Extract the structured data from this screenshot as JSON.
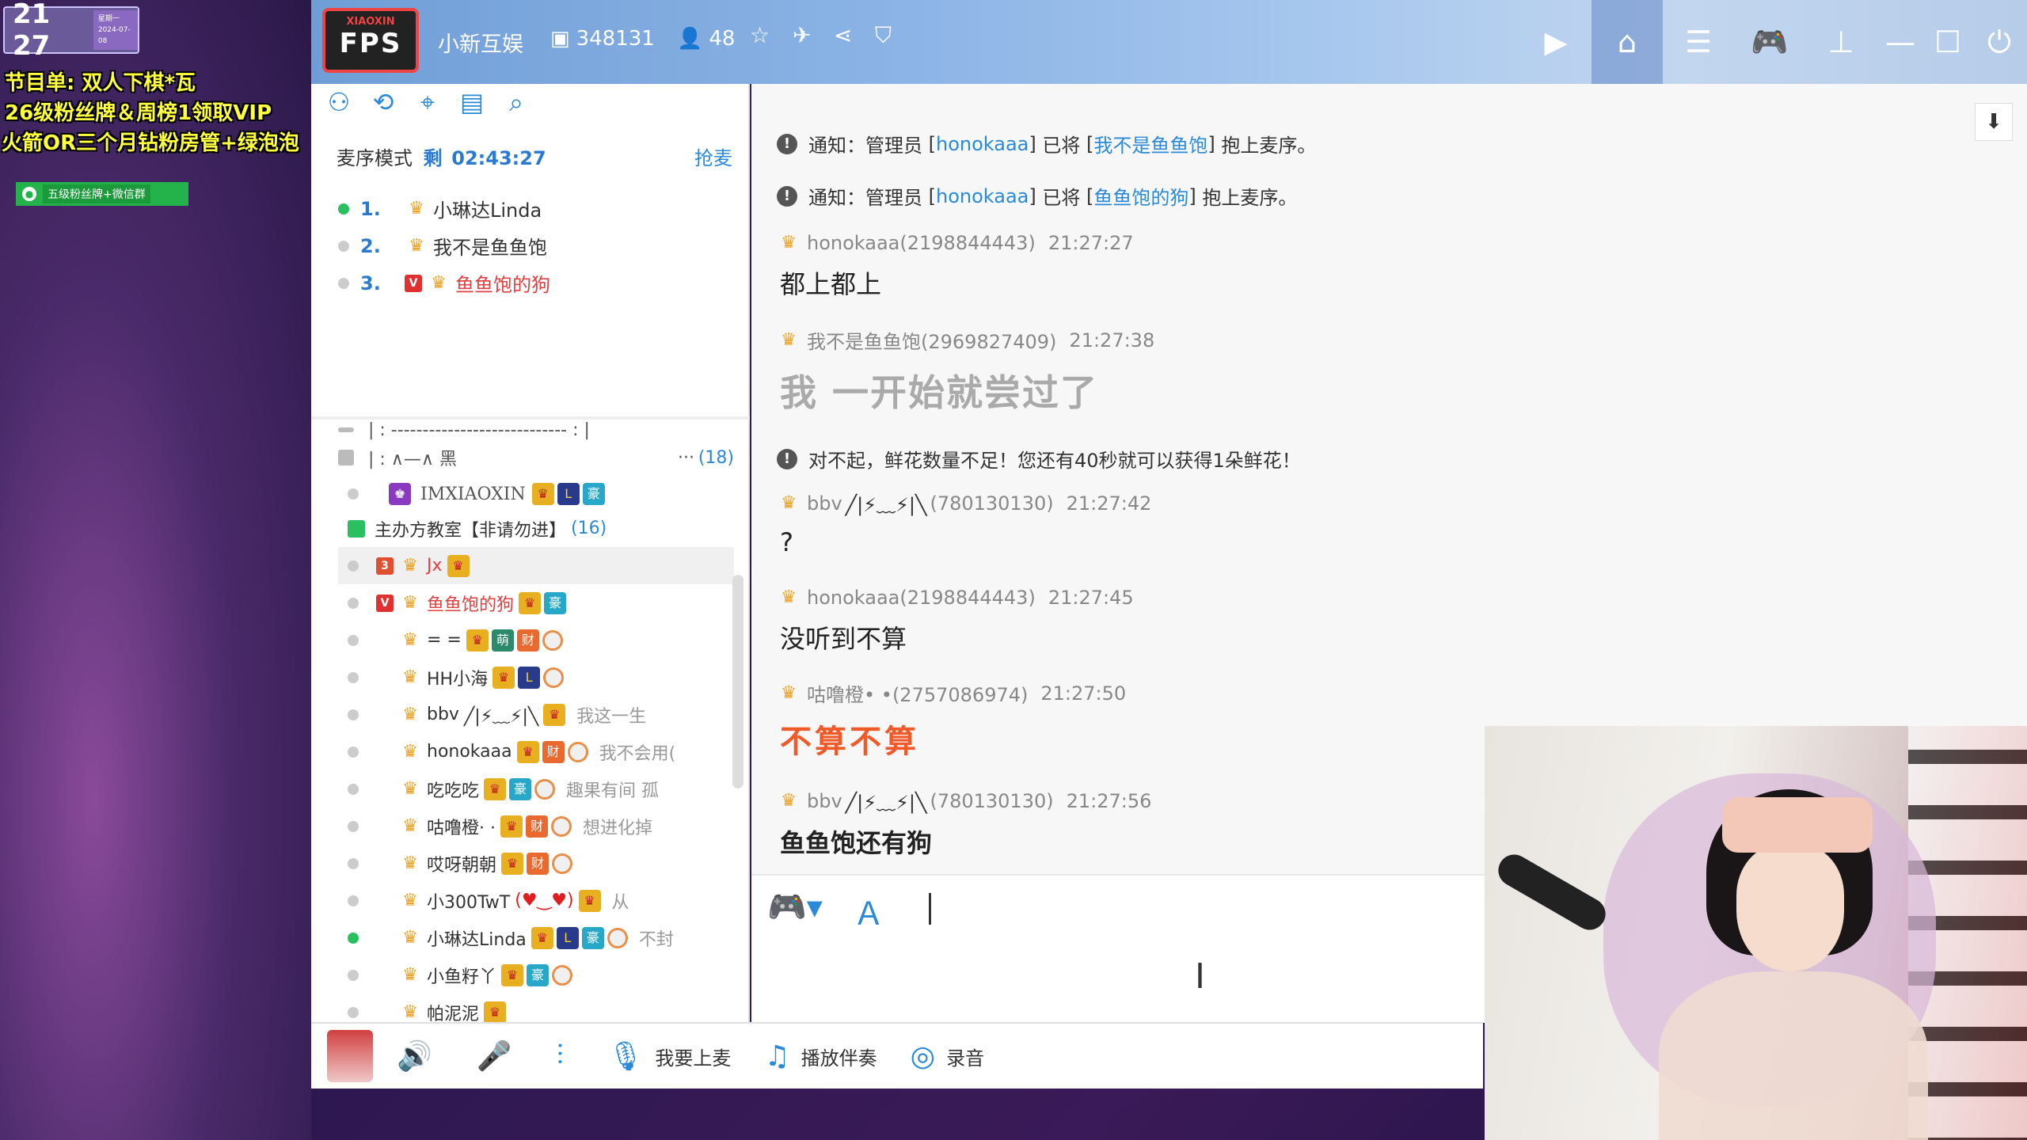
{
  "overlay": {
    "clock": "21 27",
    "clock_sub_line1": "星期一",
    "clock_sub_line2": "2024-07-08",
    "line1": "节目单: 双人下棋*瓦",
    "line2": "26级粉丝牌＆周榜1领取VIP",
    "line3": "火箭OR三个月钻粉房管+绿泡泡",
    "wechat_label": "五级粉丝牌+微信群"
  },
  "topbar": {
    "logo_top": "XIAOXIN",
    "logo_main": "FPS",
    "room_name": "小新互娱",
    "room_id": "348131",
    "online_count": "48"
  },
  "left": {
    "mode_label": "麦序模式",
    "remaining_label": "剩",
    "remaining_time": "02:43:27",
    "grab_mic": "抢麦",
    "queue": [
      {
        "num": "1.",
        "name": "小琳达Linda",
        "online": true,
        "red": false,
        "v": false
      },
      {
        "num": "2.",
        "name": "我不是鱼鱼饱",
        "online": false,
        "red": false,
        "v": false
      },
      {
        "num": "3.",
        "name": "鱼鱼饱的狗",
        "online": false,
        "red": true,
        "v": true
      }
    ],
    "channel_dashes": "| :  ----------------------------  :  |",
    "channel_name": "| :          ∧—∧         黑",
    "channel_more": "···",
    "channel_count": "(18)",
    "top_user": "IMXIAOXIN",
    "sub_channel": "主办方教室【非请勿进】",
    "sub_channel_count": "(16)",
    "users": [
      {
        "name": "Jx",
        "sig": "",
        "online": false,
        "red": true,
        "sel": true
      },
      {
        "name": "鱼鱼饱的狗",
        "sig": "",
        "online": false,
        "red": true,
        "sel": false
      },
      {
        "name": "= =",
        "sig": "",
        "online": false,
        "red": false,
        "sel": false
      },
      {
        "name": "HH小海",
        "sig": "",
        "online": false,
        "red": false,
        "sel": false
      },
      {
        "name": "bbv",
        "sig": "我这一生",
        "online": false,
        "red": false,
        "sel": false
      },
      {
        "name": "honokaaa",
        "sig": "我不会用(",
        "online": false,
        "red": false,
        "sel": false
      },
      {
        "name": "吃吃吃",
        "sig": "趣果有间 孤",
        "online": false,
        "red": false,
        "sel": false
      },
      {
        "name": "咕噜橙· ·",
        "sig": "想进化掉",
        "online": false,
        "red": false,
        "sel": false
      },
      {
        "name": "哎呀朝朝",
        "sig": "",
        "online": false,
        "red": false,
        "sel": false
      },
      {
        "name": "小300TwT",
        "sig": "从",
        "online": false,
        "red": false,
        "sel": false
      },
      {
        "name": "小琳达Linda",
        "sig": "不封",
        "online": true,
        "red": false,
        "sel": false
      },
      {
        "name": "小鱼籽丫",
        "sig": "",
        "online": false,
        "red": false,
        "sel": false
      },
      {
        "name": "帕泥泥",
        "sig": "",
        "online": false,
        "red": false,
        "sel": false
      }
    ]
  },
  "chat": {
    "notice_prefix": "通知：管理员",
    "admin": "honokaaa",
    "notice_mid": "已将",
    "notice_suffix": "抱上麦序。",
    "target1": "我不是鱼鱼饱",
    "target2": "鱼鱼饱的狗",
    "messages": [
      {
        "user": "honokaaa(2198844443)",
        "time": "21:27:27",
        "text": "都上都上"
      },
      {
        "user": "我不是鱼鱼饱(2969827409)",
        "time": "21:27:38",
        "text": "我 一开始就尝过了"
      },
      {
        "user": "bbv",
        "uid": "(780130130)",
        "time": "21:27:42",
        "text": "?"
      },
      {
        "user": "honokaaa(2198844443)",
        "time": "21:27:45",
        "text": "没听到不算"
      },
      {
        "user": "咕噜橙• •(2757086974)",
        "time": "21:27:50",
        "text": "不算不算"
      },
      {
        "user": "bbv",
        "uid": "(780130130)",
        "time": "21:27:56",
        "text": "鱼鱼饱还有狗"
      }
    ],
    "flower_notice": "对不起，鲜花数量不足！您还有40秒就可以获得1朵鲜花！",
    "bbv_deco": "╱|⚡﹏⚡|╲"
  },
  "bottom": {
    "go_on_mic": "我要上麦",
    "play_music": "播放伴奏",
    "record": "录音"
  },
  "colors": {
    "accent": "#2a8ad8",
    "online": "#2ac060",
    "highlight": "#f05a28"
  }
}
